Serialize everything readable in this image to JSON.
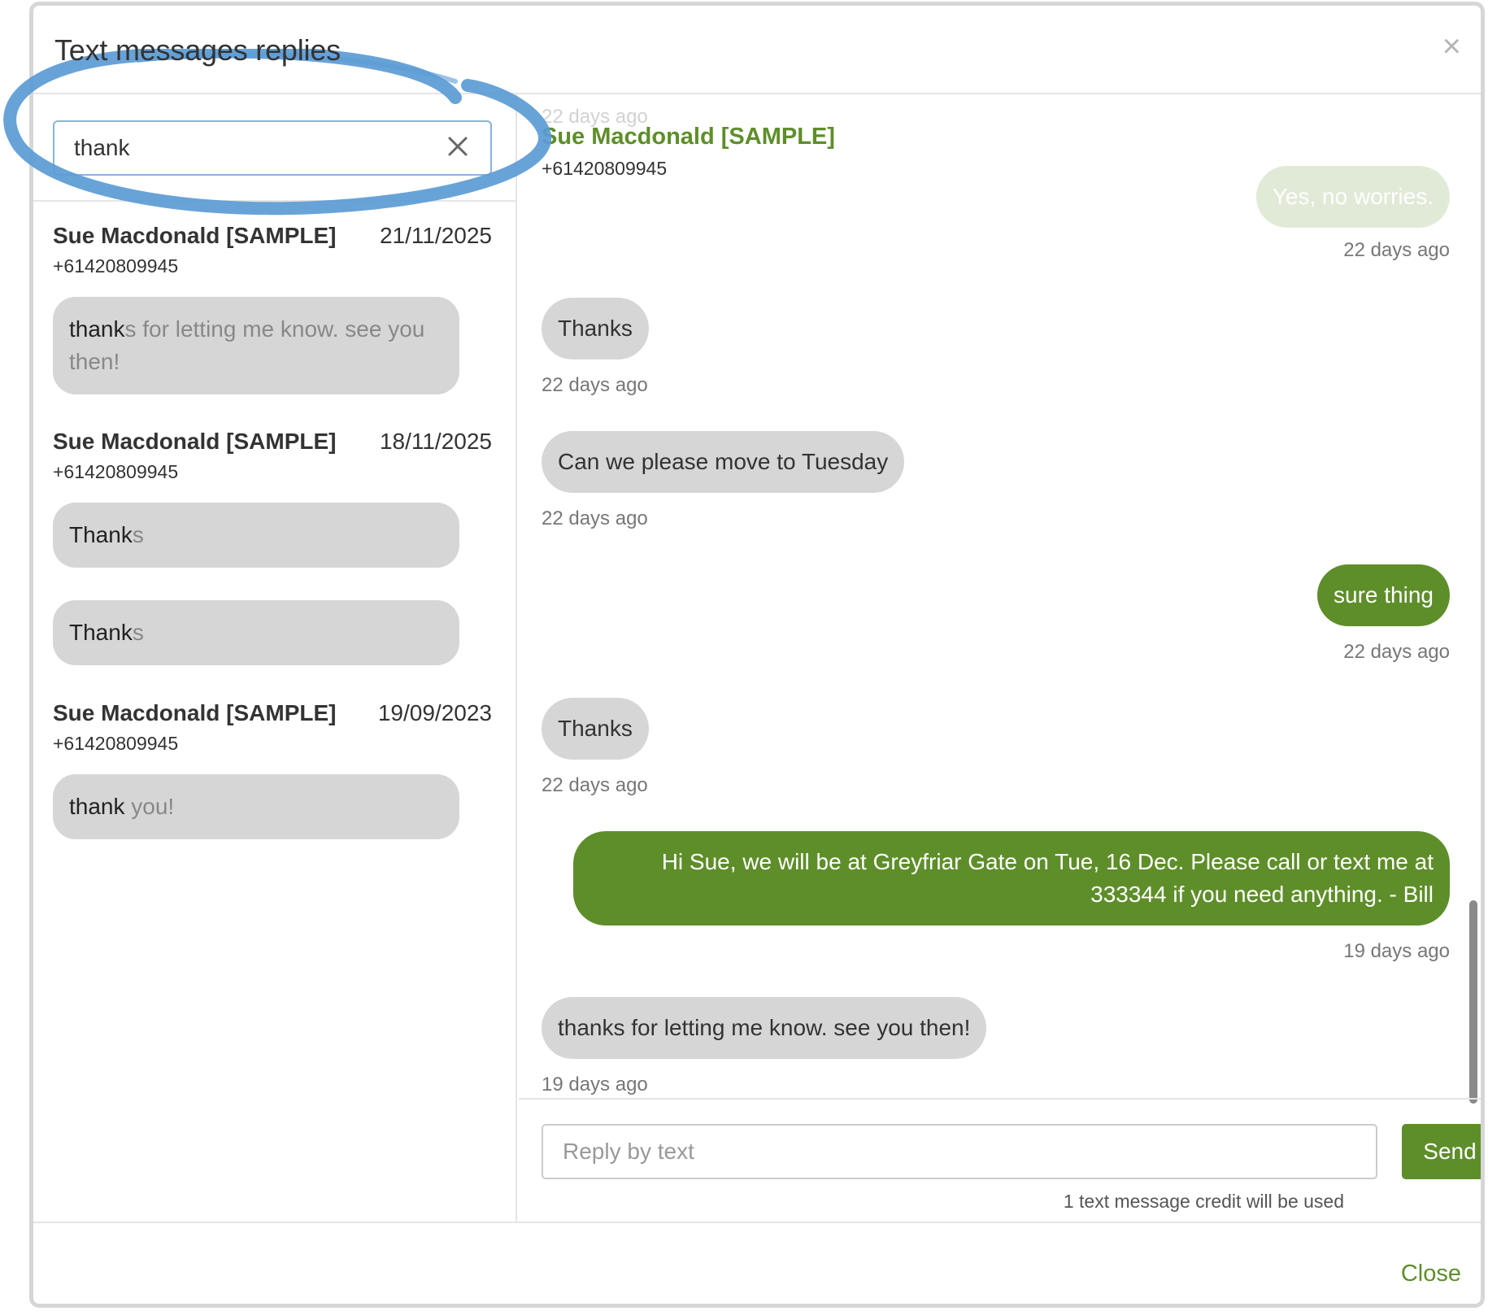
{
  "modal": {
    "title": "Text messages replies",
    "close_icon": "close-icon",
    "close_label": "Close"
  },
  "search": {
    "value": "thank",
    "clear_icon": "clear-icon"
  },
  "results": [
    {
      "name": "Sue Macdonald [SAMPLE]",
      "date": "21/11/2025",
      "phone": "+61420809945",
      "messages": [
        {
          "match": "thank",
          "rest": "s for letting me know. see you then!"
        }
      ]
    },
    {
      "name": "Sue Macdonald [SAMPLE]",
      "date": "18/11/2025",
      "phone": "+61420809945",
      "messages": [
        {
          "match": "Thank",
          "rest": "s"
        },
        {
          "match": "Thank",
          "rest": "s"
        }
      ]
    },
    {
      "name": "Sue Macdonald [SAMPLE]",
      "date": "19/09/2023",
      "phone": "+61420809945",
      "messages": [
        {
          "match": "thank",
          "rest": " you!"
        }
      ]
    }
  ],
  "conversation": {
    "top_timestamp": "22 days ago",
    "contact_name": "Sue Macdonald [SAMPLE]",
    "contact_phone": "+61420809945",
    "messages": [
      {
        "direction": "out",
        "text": "Yes, no worries.",
        "time": "22 days ago"
      },
      {
        "direction": "in",
        "text": "Thanks",
        "time": "22 days ago"
      },
      {
        "direction": "in",
        "text": "Can we please move to Tuesday",
        "time": "22 days ago"
      },
      {
        "direction": "out",
        "text": "sure thing",
        "time": "22 days ago"
      },
      {
        "direction": "in",
        "text": "Thanks",
        "time": "22 days ago"
      },
      {
        "direction": "out",
        "text": "Hi Sue, we will be at Greyfriar Gate on Tue, 16 Dec. Please call or text me at 333344 if you need anything. - Bill",
        "time": "19 days ago"
      },
      {
        "direction": "in",
        "text": "thanks for letting me know. see you then!",
        "time": "19 days ago"
      }
    ]
  },
  "reply": {
    "placeholder": "Reply by text",
    "send_label": "Send",
    "credit_note": "1 text message credit will be used"
  },
  "colors": {
    "accent": "#5e8e2a",
    "bubble_in": "#d6d6d6",
    "annotation": "#5b9bd5"
  }
}
